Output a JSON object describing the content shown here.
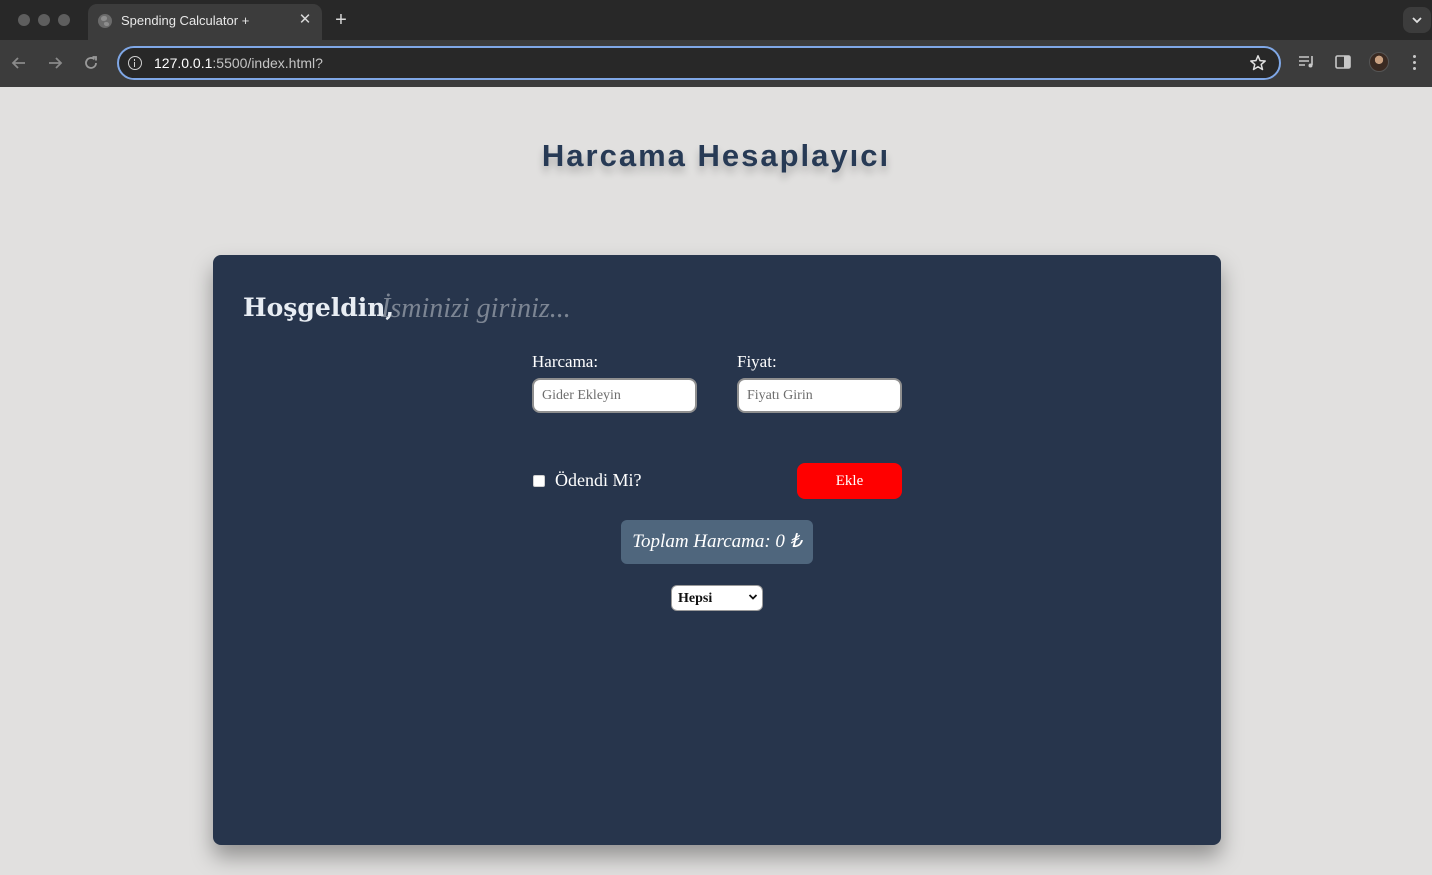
{
  "browser": {
    "tab_title": "Spending Calculator +",
    "close_glyph": "✕",
    "new_tab_glyph": "+",
    "url_host": "127.0.0.1",
    "url_path": ":5500/index.html?"
  },
  "page": {
    "title": "Harcama Hesaplayıcı"
  },
  "form": {
    "welcome": "Hoşgeldin,",
    "name_placeholder": "İsminizi giriniz...",
    "expense_label": "Harcama:",
    "expense_placeholder": "Gider Ekleyin",
    "price_label": "Fiyat:",
    "price_placeholder": "Fiyatı Girin",
    "paid_label": "Ödendi Mi?",
    "paid_checked": false,
    "add_button": "Ekle",
    "total_text": "Toplam Harcama: 0 ₺",
    "filter_selected": "Hepsi"
  },
  "colors": {
    "page_background": "#e1e0df",
    "card_background": "#27354c",
    "title_color": "#273a55",
    "add_button": "#ff0000",
    "total_box": "#4f667d",
    "omnibox_focus": "#7fa7e6"
  },
  "icons": [
    "globe-icon",
    "close-icon",
    "plus-icon",
    "chevron-down-icon",
    "back-arrow-icon",
    "forward-arrow-icon",
    "reload-icon",
    "info-icon",
    "star-icon",
    "reading-list-icon",
    "side-panel-icon",
    "profile-avatar",
    "more-options-icon"
  ]
}
